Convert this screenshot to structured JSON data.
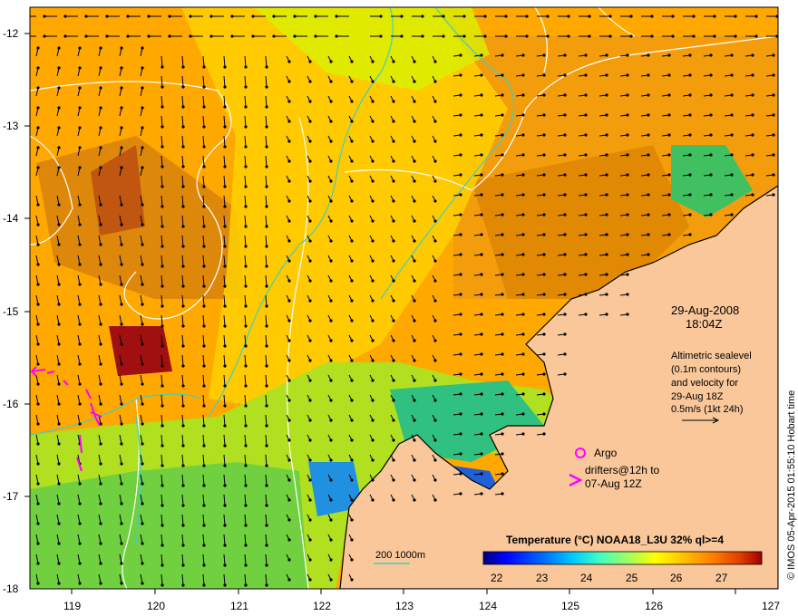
{
  "map": {
    "x_ticks": [
      "119",
      "120",
      "121",
      "122",
      "123",
      "124",
      "125",
      "126",
      "127"
    ],
    "y_ticks": [
      "-12",
      "-13",
      "-14",
      "-15",
      "-16",
      "-17",
      "-18"
    ]
  },
  "annotations": {
    "date": "29-Aug-2008",
    "time": "18:04Z",
    "altimetric_lines": [
      "Altimetric sealevel",
      "(0.1m contours)",
      "and velocity for",
      "29-Aug 18Z",
      "0.5m/s (1kt 24h)"
    ],
    "argo_label": "Argo",
    "drifters_lines": [
      "drifters@12h to",
      "07-Aug 12Z"
    ],
    "depth_legend": "200  1000m",
    "credit": "© IMOS 05-Apr-2015 01:55:10 Hobart time"
  },
  "colorbar": {
    "title": "Temperature (°C) NOAA18_L3U 32% ql>=4",
    "tick_labels": [
      "22",
      "23",
      "24",
      "25",
      "26",
      "27"
    ],
    "colors": [
      "#00007f",
      "#0000ff",
      "#0070ff",
      "#00c8ff",
      "#40ffc0",
      "#a0ff60",
      "#ffff00",
      "#ffc000",
      "#ff8000",
      "#e04000",
      "#a00000"
    ]
  },
  "colors": {
    "land": "#f9c79a",
    "argo": "#ff00ff",
    "drifter": "#ff00ff",
    "isobath": "#40d0c0",
    "contour": "#ffffff"
  }
}
